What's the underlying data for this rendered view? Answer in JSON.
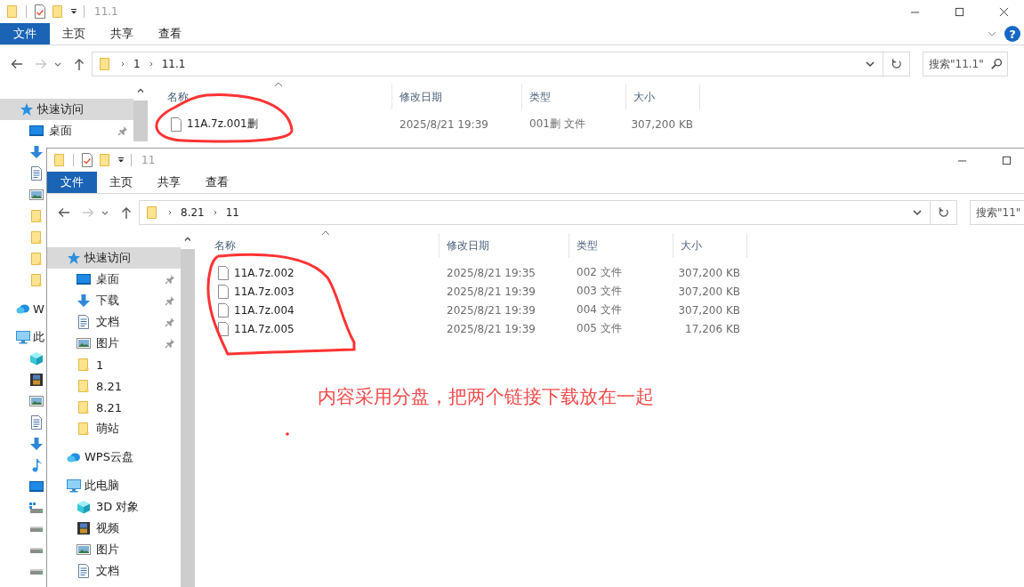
{
  "windows": [
    {
      "title": "11.1",
      "help": "?",
      "ribbon_tabs": [
        {
          "label": "文件",
          "kind": "file"
        },
        {
          "label": "主页",
          "kind": "tab"
        },
        {
          "label": "共享",
          "kind": "tab"
        },
        {
          "label": "查看",
          "kind": "tab"
        }
      ],
      "breadcrumb": [
        "1",
        "11.1"
      ],
      "search": {
        "placeholder": "搜索\"11.1\""
      },
      "nav": [
        {
          "label": "快速访问",
          "kind": "quick",
          "selected": true,
          "pinned": false,
          "children": [
            {
              "label": "桌面",
              "kind": "desktop",
              "selected": false,
              "pinned": true
            },
            {
              "kind": "download",
              "selected": false
            },
            {
              "kind": "document",
              "selected": false
            },
            {
              "kind": "picture",
              "selected": false
            },
            {
              "kind": "folder",
              "selected": false
            },
            {
              "kind": "folder",
              "selected": false
            },
            {
              "kind": "folder",
              "selected": false
            },
            {
              "kind": "folder",
              "selected": false
            }
          ]
        },
        {
          "label": "W",
          "kind": "cloud",
          "selected": false
        },
        {
          "label": "此",
          "kind": "pc",
          "selected": false,
          "children": [
            {
              "kind": "cube",
              "selected": false
            },
            {
              "kind": "video",
              "selected": false
            },
            {
              "kind": "picture",
              "selected": false
            },
            {
              "kind": "document",
              "selected": false
            },
            {
              "kind": "download",
              "selected": false
            },
            {
              "kind": "music",
              "selected": false
            },
            {
              "kind": "desktop",
              "selected": false
            },
            {
              "kind": "drive_win",
              "selected": false
            },
            {
              "kind": "drive",
              "selected": false
            },
            {
              "kind": "drive",
              "selected": false
            },
            {
              "kind": "drive",
              "selected": false
            }
          ]
        }
      ],
      "columns": [
        "名称",
        "修改日期",
        "类型",
        "大小"
      ],
      "files": [
        {
          "name": "11A.7z.001删",
          "modified": "2025/8/21 19:39",
          "type": "001删 文件",
          "size": "307,200 KB"
        }
      ]
    },
    {
      "title": "11",
      "ribbon_tabs": [
        {
          "label": "文件",
          "kind": "file"
        },
        {
          "label": "主页",
          "kind": "tab"
        },
        {
          "label": "共享",
          "kind": "tab"
        },
        {
          "label": "查看",
          "kind": "tab"
        }
      ],
      "breadcrumb": [
        "8.21",
        "11"
      ],
      "search": {
        "placeholder": "搜索\"11\""
      },
      "nav": [
        {
          "label": "快速访问",
          "kind": "quick",
          "selected": true,
          "pinned": false,
          "children": [
            {
              "label": "桌面",
              "kind": "desktop",
              "selected": false,
              "pinned": true
            },
            {
              "label": "下载",
              "kind": "download",
              "selected": false,
              "pinned": true
            },
            {
              "label": "文档",
              "kind": "document",
              "selected": false,
              "pinned": true
            },
            {
              "label": "图片",
              "kind": "picture",
              "selected": false,
              "pinned": true
            },
            {
              "label": "1",
              "kind": "folder",
              "selected": false,
              "pinned": false
            },
            {
              "label": "8.21",
              "kind": "folder",
              "selected": false,
              "pinned": false
            },
            {
              "label": "8.21",
              "kind": "folder",
              "selected": false,
              "pinned": false
            },
            {
              "label": "萌站",
              "kind": "folder",
              "selected": false,
              "pinned": false
            }
          ]
        },
        {
          "label": "WPS云盘",
          "kind": "cloud",
          "selected": false,
          "pinned": false
        },
        {
          "label": "此电脑",
          "kind": "pc",
          "selected": false,
          "pinned": false,
          "children": [
            {
              "label": "3D 对象",
              "kind": "cube",
              "selected": false,
              "pinned": false
            },
            {
              "label": "视频",
              "kind": "video",
              "selected": false,
              "pinned": false
            },
            {
              "label": "图片",
              "kind": "picture",
              "selected": false,
              "pinned": false
            },
            {
              "label": "文档",
              "kind": "document",
              "selected": false,
              "pinned": false
            }
          ]
        }
      ],
      "columns": [
        "名称",
        "修改日期",
        "类型",
        "大小"
      ],
      "files": [
        {
          "name": "11A.7z.002",
          "modified": "2025/8/21 19:35",
          "type": "002 文件",
          "size": "307,200 KB"
        },
        {
          "name": "11A.7z.003",
          "modified": "2025/8/21 19:39",
          "type": "003 文件",
          "size": "307,200 KB"
        },
        {
          "name": "11A.7z.004",
          "modified": "2025/8/21 19:39",
          "type": "004 文件",
          "size": "307,200 KB"
        },
        {
          "name": "11A.7z.005",
          "modified": "2025/8/21 19:39",
          "type": "005 文件",
          "size": "17,206 KB"
        }
      ]
    }
  ],
  "annotation": {
    "note": "内容采用分盘，把两个链接下载放在一起"
  }
}
